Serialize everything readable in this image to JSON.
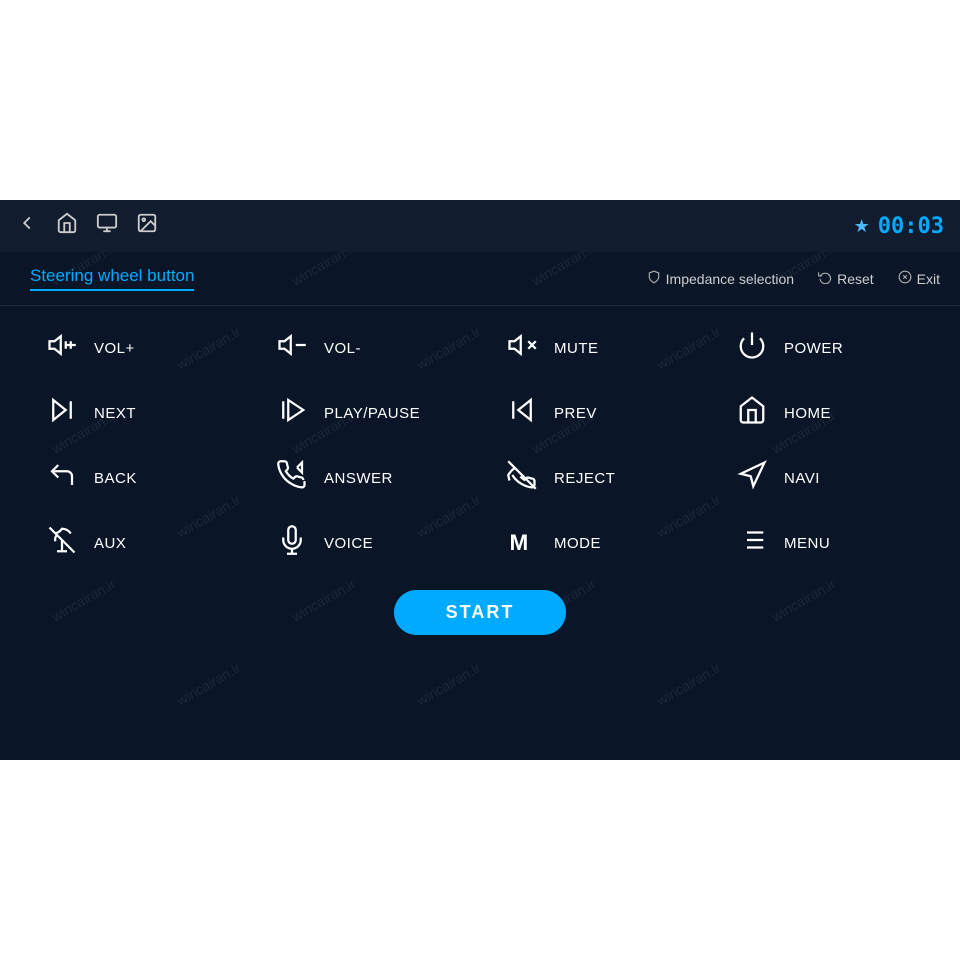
{
  "topBar": {
    "icons": [
      "back-icon",
      "home-icon",
      "screen-icon",
      "image-icon"
    ],
    "bluetooth": "✱",
    "time": "00:03"
  },
  "titleBar": {
    "title": "Steering wheel button",
    "actions": [
      {
        "icon": "shield-icon",
        "label": "Impedance selection"
      },
      {
        "icon": "reset-icon",
        "label": "Reset"
      },
      {
        "icon": "exit-icon",
        "label": "Exit"
      }
    ]
  },
  "buttons": [
    {
      "id": "vol-plus",
      "icon": "vol-plus",
      "label": "VOL+"
    },
    {
      "id": "vol-minus",
      "icon": "vol-minus",
      "label": "VOL-"
    },
    {
      "id": "mute",
      "icon": "mute",
      "label": "MUTE"
    },
    {
      "id": "power",
      "icon": "power",
      "label": "POWER"
    },
    {
      "id": "next",
      "icon": "next",
      "label": "NEXT"
    },
    {
      "id": "play-pause",
      "icon": "play-pause",
      "label": "PLAY/PAUSE"
    },
    {
      "id": "prev",
      "icon": "prev",
      "label": "PREV"
    },
    {
      "id": "home",
      "icon": "home",
      "label": "HOME"
    },
    {
      "id": "back",
      "icon": "back",
      "label": "BACK"
    },
    {
      "id": "answer",
      "icon": "answer",
      "label": "ANSWER"
    },
    {
      "id": "reject",
      "icon": "reject",
      "label": "REJECT"
    },
    {
      "id": "navi",
      "icon": "navi",
      "label": "NAVI"
    },
    {
      "id": "aux",
      "icon": "aux",
      "label": "AUX"
    },
    {
      "id": "voice",
      "icon": "voice",
      "label": "VOICE"
    },
    {
      "id": "mode",
      "icon": "mode",
      "label": "MODE"
    },
    {
      "id": "menu",
      "icon": "menu",
      "label": "MENU"
    }
  ],
  "startButton": {
    "label": "START"
  },
  "watermarkText": "wincairan.ir"
}
